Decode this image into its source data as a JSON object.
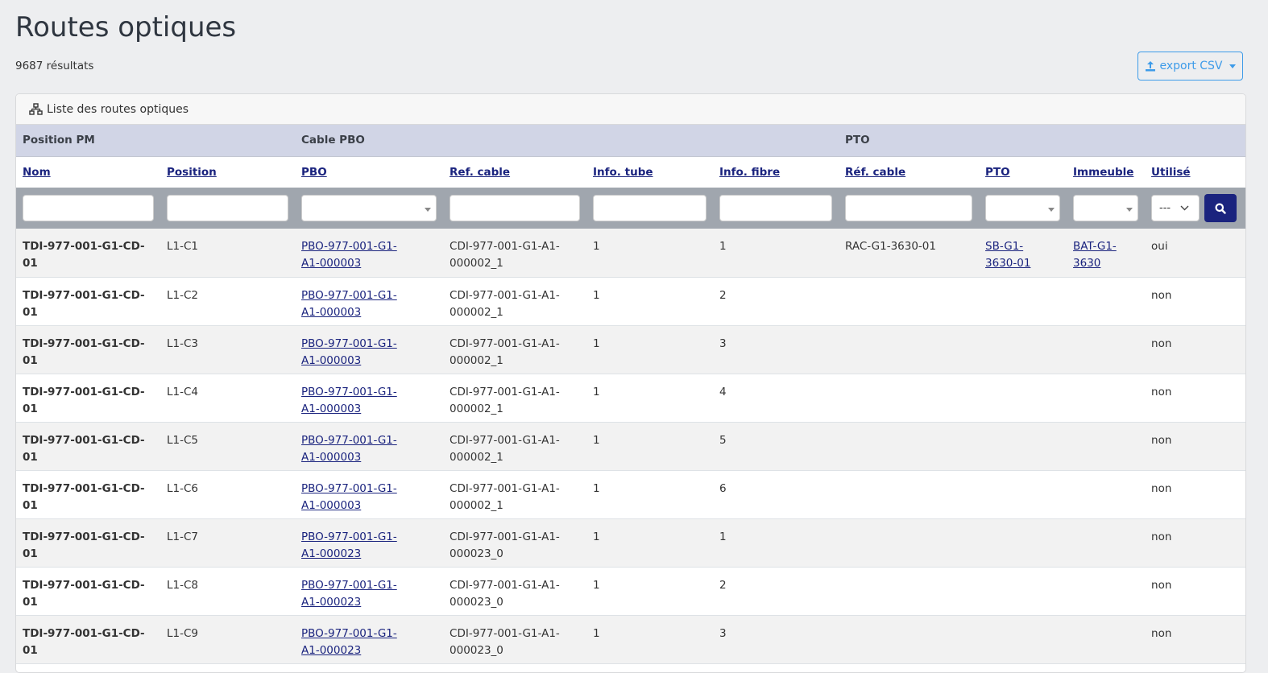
{
  "title": "Routes optiques",
  "result_count": "9687 résultats",
  "export_label": "export CSV",
  "card_title": "Liste des routes optiques",
  "groups": {
    "pm": "Position PM",
    "pbo": "Cable PBO",
    "pto": "PTO"
  },
  "columns": [
    "Nom",
    "Position",
    "PBO",
    "Ref. cable",
    "Info. tube",
    "Info. fibre",
    "Réf. cable",
    "PTO",
    "Immeuble",
    "Utilisé"
  ],
  "filter_utilise": "---",
  "rows": [
    {
      "nom": "TDI-977-001-G1-CD-01",
      "position": "L1-C1",
      "pbo": "PBO-977-001-G1-A1-000003",
      "ref": "CDI-977-001-G1-A1-000002_1",
      "tube": "1",
      "fibre": "1",
      "pto_ref": "RAC-G1-3630-01",
      "pto": "SB-G1-3630-01",
      "immeuble": "BAT-G1-3630",
      "utilise": "oui"
    },
    {
      "nom": "TDI-977-001-G1-CD-01",
      "position": "L1-C2",
      "pbo": "PBO-977-001-G1-A1-000003",
      "ref": "CDI-977-001-G1-A1-000002_1",
      "tube": "1",
      "fibre": "2",
      "pto_ref": "",
      "pto": "",
      "immeuble": "",
      "utilise": "non"
    },
    {
      "nom": "TDI-977-001-G1-CD-01",
      "position": "L1-C3",
      "pbo": "PBO-977-001-G1-A1-000003",
      "ref": "CDI-977-001-G1-A1-000002_1",
      "tube": "1",
      "fibre": "3",
      "pto_ref": "",
      "pto": "",
      "immeuble": "",
      "utilise": "non"
    },
    {
      "nom": "TDI-977-001-G1-CD-01",
      "position": "L1-C4",
      "pbo": "PBO-977-001-G1-A1-000003",
      "ref": "CDI-977-001-G1-A1-000002_1",
      "tube": "1",
      "fibre": "4",
      "pto_ref": "",
      "pto": "",
      "immeuble": "",
      "utilise": "non"
    },
    {
      "nom": "TDI-977-001-G1-CD-01",
      "position": "L1-C5",
      "pbo": "PBO-977-001-G1-A1-000003",
      "ref": "CDI-977-001-G1-A1-000002_1",
      "tube": "1",
      "fibre": "5",
      "pto_ref": "",
      "pto": "",
      "immeuble": "",
      "utilise": "non"
    },
    {
      "nom": "TDI-977-001-G1-CD-01",
      "position": "L1-C6",
      "pbo": "PBO-977-001-G1-A1-000003",
      "ref": "CDI-977-001-G1-A1-000002_1",
      "tube": "1",
      "fibre": "6",
      "pto_ref": "",
      "pto": "",
      "immeuble": "",
      "utilise": "non"
    },
    {
      "nom": "TDI-977-001-G1-CD-01",
      "position": "L1-C7",
      "pbo": "PBO-977-001-G1-A1-000023",
      "ref": "CDI-977-001-G1-A1-000023_0",
      "tube": "1",
      "fibre": "1",
      "pto_ref": "",
      "pto": "",
      "immeuble": "",
      "utilise": "non"
    },
    {
      "nom": "TDI-977-001-G1-CD-01",
      "position": "L1-C8",
      "pbo": "PBO-977-001-G1-A1-000023",
      "ref": "CDI-977-001-G1-A1-000023_0",
      "tube": "1",
      "fibre": "2",
      "pto_ref": "",
      "pto": "",
      "immeuble": "",
      "utilise": "non"
    },
    {
      "nom": "TDI-977-001-G1-CD-01",
      "position": "L1-C9",
      "pbo": "PBO-977-001-G1-A1-000023",
      "ref": "CDI-977-001-G1-A1-000023_0",
      "tube": "1",
      "fibre": "3",
      "pto_ref": "",
      "pto": "",
      "immeuble": "",
      "utilise": "non"
    }
  ]
}
